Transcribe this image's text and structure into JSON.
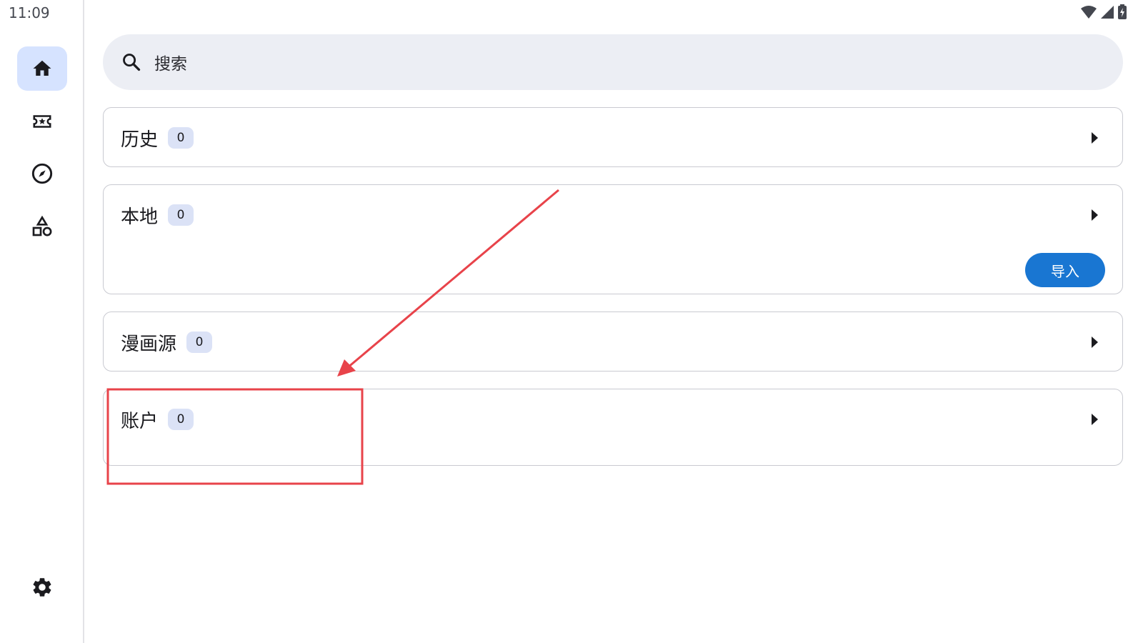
{
  "status_bar": {
    "time": "11:09",
    "icons": [
      "wifi-icon",
      "cell-signal-icon",
      "battery-icon"
    ]
  },
  "nav_rail": {
    "items": [
      {
        "icon": "home-icon",
        "active": true
      },
      {
        "icon": "ticket-star-icon",
        "active": false
      },
      {
        "icon": "compass-icon",
        "active": false
      },
      {
        "icon": "shapes-icon",
        "active": false
      }
    ],
    "bottom_icon": "gear-icon"
  },
  "search": {
    "placeholder": "搜索"
  },
  "sections": [
    {
      "title": "历史",
      "count": "0"
    },
    {
      "title": "本地",
      "count": "0",
      "action": "导入"
    },
    {
      "title": "漫画源",
      "count": "0"
    },
    {
      "title": "账户",
      "count": "0"
    }
  ],
  "colors": {
    "accent": "#1976d2",
    "rail_active_bg": "#d6e3ff",
    "search_bg": "#eceef4",
    "badge_bg": "#dbe2f6",
    "annotation": "#e8434a"
  }
}
